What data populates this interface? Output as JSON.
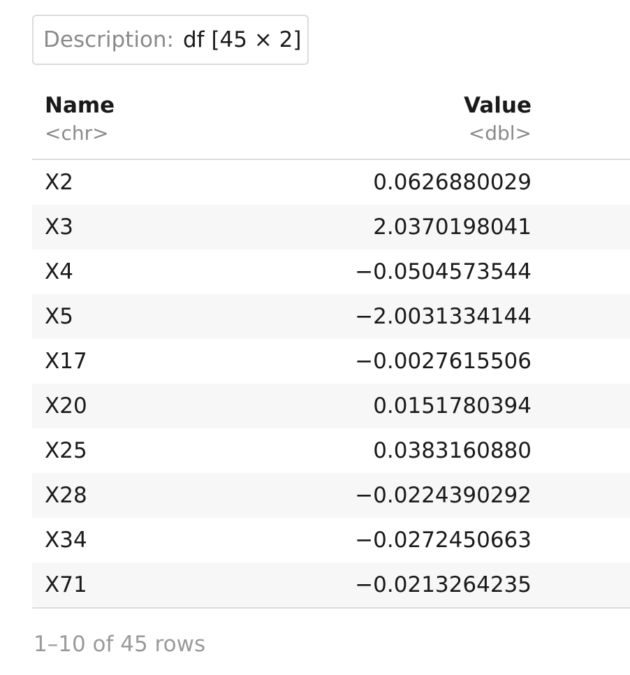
{
  "description": {
    "label": "Description:",
    "value": "df [45 × 2]"
  },
  "table": {
    "columns": [
      {
        "title": "Name",
        "type": "<chr>"
      },
      {
        "title": "Value",
        "type": "<dbl>"
      }
    ],
    "rows": [
      {
        "name": "X2",
        "value": "0.0626880029"
      },
      {
        "name": "X3",
        "value": "2.0370198041"
      },
      {
        "name": "X4",
        "value": "−0.0504573544"
      },
      {
        "name": "X5",
        "value": "−2.0031334144"
      },
      {
        "name": "X17",
        "value": "−0.0027615506"
      },
      {
        "name": "X20",
        "value": "0.0151780394"
      },
      {
        "name": "X25",
        "value": "0.0383160880"
      },
      {
        "name": "X28",
        "value": "−0.0224390292"
      },
      {
        "name": "X34",
        "value": "−0.0272450663"
      },
      {
        "name": "X71",
        "value": "−0.0213264235"
      }
    ]
  },
  "footer": {
    "pagination": "1–10 of 45 rows"
  }
}
